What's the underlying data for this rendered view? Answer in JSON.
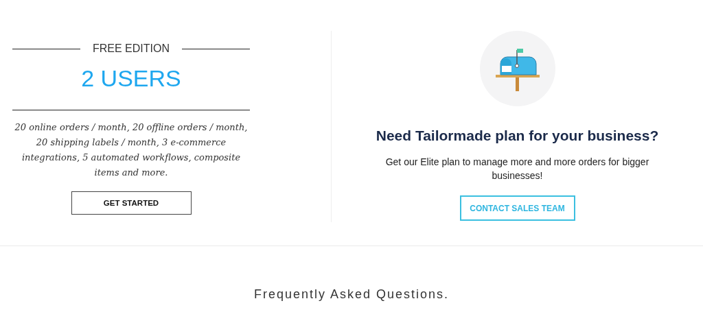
{
  "free_plan": {
    "edition": "FREE EDITION",
    "users": "2 USERS",
    "description": "20 online orders / month, 20 offline orders / month, 20 shipping labels / month, 3 e-commerce integrations, 5 automated workflows, composite items and more.",
    "button": "GET STARTED"
  },
  "elite_plan": {
    "heading": "Need Tailormade plan for your business?",
    "description": "Get our Elite plan to manage more and more orders for bigger businesses!",
    "button": "CONTACT SALES TEAM"
  },
  "faq": {
    "title": "Frequently Asked Questions."
  }
}
